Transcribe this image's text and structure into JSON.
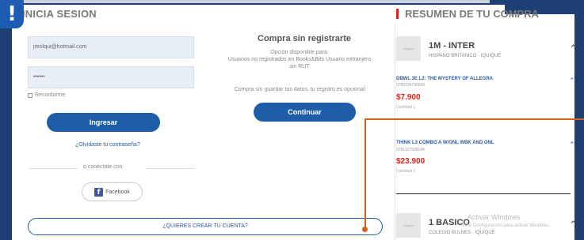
{
  "login": {
    "heading": "INICIA SESION",
    "email_value": "jreolqui@hotmail.com",
    "password_value": "••••••",
    "remember_label": "Recordarme",
    "login_button": "Ingresar",
    "forgot_link": "¿Olvidaste tu contraseña?",
    "or_connect": "o conéctate con",
    "facebook_button": "Facebook",
    "create_account": "¿QUIERES CREAR TU CUENTA?"
  },
  "guest": {
    "title": "Compra sin registrarte",
    "desc_line1": "Opción disponible para:",
    "desc_line2": "Usuarios no registrados en Books&Bits Usuario extranjero",
    "desc_line3": "sin RUT",
    "note": "Compra sin guardar tus datos, tu registro es opcional",
    "continue_button": "Continuar"
  },
  "summary": {
    "heading": "RESUMEN DE TU COMPRA",
    "thumb_label": "Imagen",
    "groups": [
      {
        "title": "1M - INTER",
        "subtitle": "HISPANO BRITANICO - IQUIQUE"
      },
      {
        "title": "1 BASICO",
        "subtitle": "COLEGIO BULNES - IQUIQUE"
      }
    ],
    "items": [
      {
        "title": "DBWL 3E L2: THE MYSTERY OF ALLEGRA",
        "isbn": "9780194790666",
        "price": "$7.900",
        "qty": "Cantidad 1"
      },
      {
        "title": "THINK L3 COMBO A W/ONL WBK AND ONL",
        "isbn": "9781107509184",
        "price": "$23.900",
        "qty": "Cantidad 1"
      }
    ]
  },
  "overlay": {
    "alert_badge": "!",
    "watermark_title": "Activar Windows",
    "watermark_sub": "Ve a Configuración para activar Windows."
  },
  "colors": {
    "frame": "#1e3f73",
    "primary": "#1e5ea8",
    "price": "#e2231a",
    "callout": "#d4601a"
  },
  "icons": [
    "chevron-up-icon",
    "facebook-icon",
    "alert-icon"
  ]
}
